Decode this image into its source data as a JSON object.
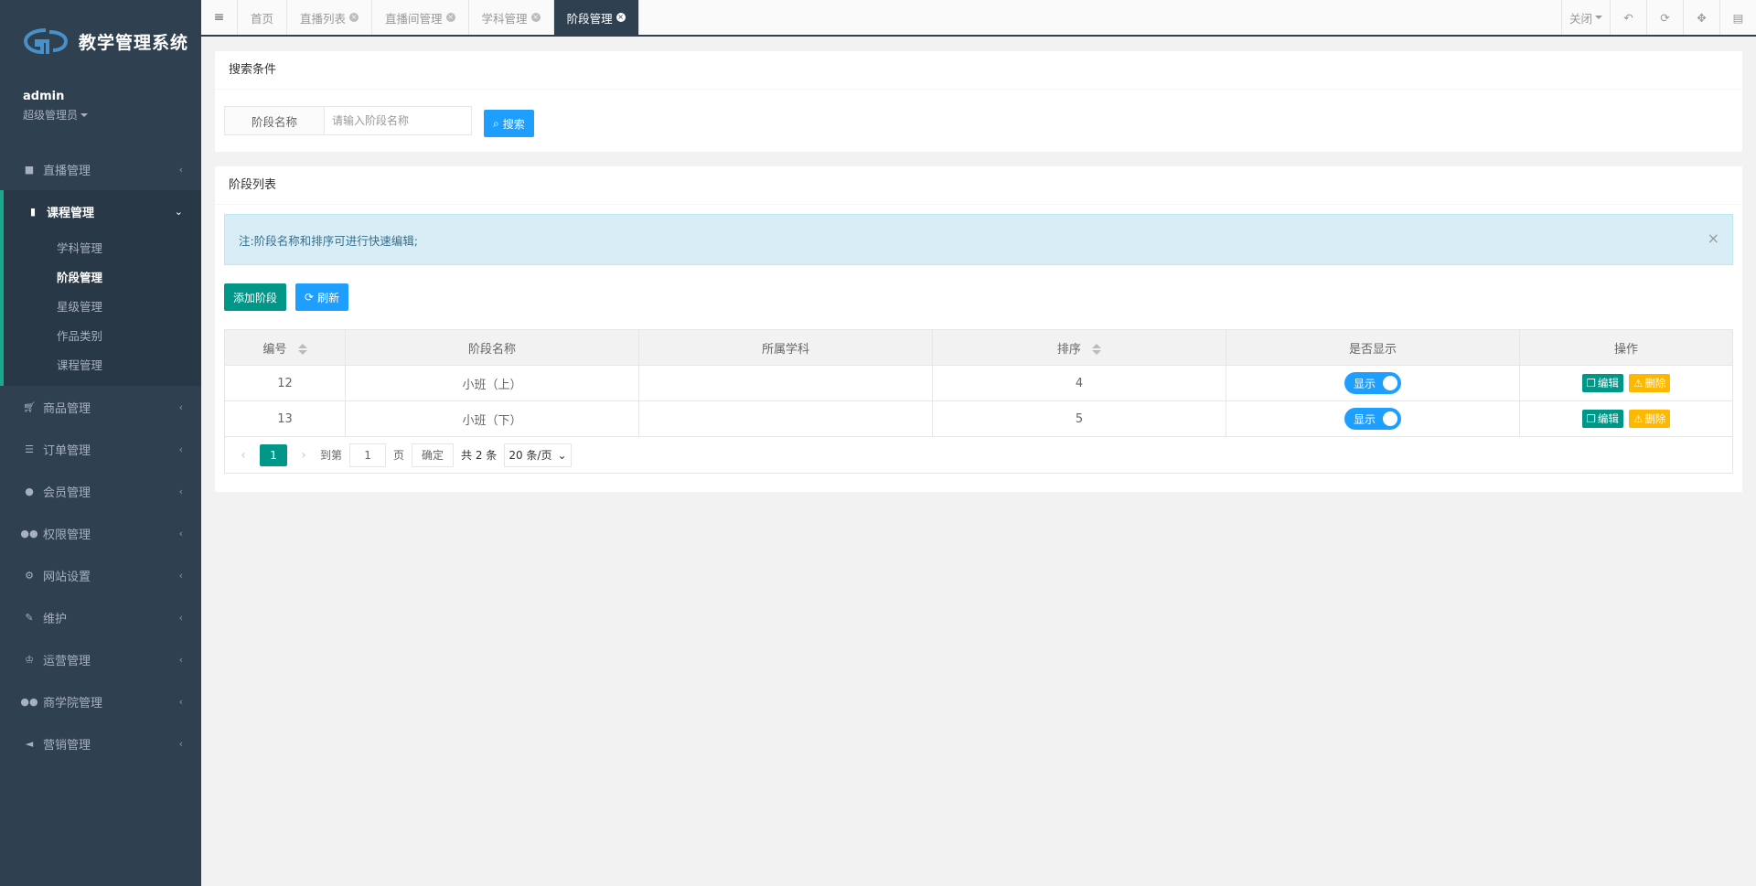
{
  "brand": {
    "title": "教学管理系统"
  },
  "user": {
    "name": "admin",
    "role": "超级管理员"
  },
  "sidebar": {
    "items": [
      {
        "label": "直播管理",
        "icon": "video-icon"
      },
      {
        "label": "课程管理",
        "icon": "book-icon",
        "active": true,
        "children": [
          "学科管理",
          "阶段管理",
          "星级管理",
          "作品类别",
          "课程管理"
        ]
      },
      {
        "label": "商品管理",
        "icon": "cart-icon"
      },
      {
        "label": "订单管理",
        "icon": "list-icon"
      },
      {
        "label": "会员管理",
        "icon": "user-icon"
      },
      {
        "label": "权限管理",
        "icon": "users-icon"
      },
      {
        "label": "网站设置",
        "icon": "gear-icon"
      },
      {
        "label": "维护",
        "icon": "wrench-icon"
      },
      {
        "label": "运营管理",
        "icon": "trophy-icon"
      },
      {
        "label": "商学院管理",
        "icon": "users-icon"
      },
      {
        "label": "营销管理",
        "icon": "megaphone-icon"
      }
    ]
  },
  "tabs": [
    {
      "label": "首页"
    },
    {
      "label": "直播列表"
    },
    {
      "label": "直播间管理"
    },
    {
      "label": "学科管理"
    },
    {
      "label": "阶段管理",
      "active": true
    }
  ],
  "toolbar": {
    "close_label": "关闭"
  },
  "search": {
    "title": "搜索条件",
    "field_label": "阶段名称",
    "placeholder": "请输入阶段名称",
    "button": "搜索"
  },
  "list": {
    "title": "阶段列表",
    "notice": "注:阶段名称和排序可进行快速编辑;",
    "add_button": "添加阶段",
    "refresh_button": "刷新",
    "columns": [
      "编号",
      "阶段名称",
      "所属学科",
      "排序",
      "是否显示",
      "操作"
    ],
    "rows": [
      {
        "id": "12",
        "name": "小班（上）",
        "subject": "",
        "sort": "4",
        "show": "显示"
      },
      {
        "id": "13",
        "name": "小班（下）",
        "subject": "",
        "sort": "5",
        "show": "显示"
      }
    ],
    "edit_label": "编辑",
    "delete_label": "删除"
  },
  "pager": {
    "current": "1",
    "goto_label": "到第",
    "page_input": "1",
    "page_unit": "页",
    "confirm": "确定",
    "total": "共 2 条",
    "page_size": "20 条/页"
  },
  "colors": {
    "sidebar": "#2f4050",
    "accent_green": "#009688",
    "accent_blue": "#1e9fff",
    "warn": "#ffb800"
  }
}
